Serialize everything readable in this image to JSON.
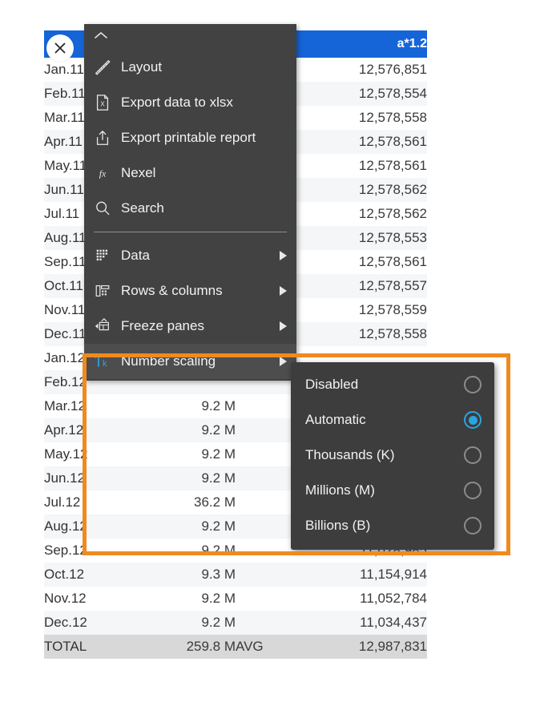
{
  "header": {
    "column_label": "a*1.2",
    "accent_color": "#1565d8"
  },
  "close_button": {
    "icon": "close-icon"
  },
  "table": {
    "columns": [
      "",
      "",
      "",
      "a*1.2"
    ],
    "rows": [
      {
        "label": "Jan.11",
        "value": "",
        "agg": "",
        "value2": "12,576,851"
      },
      {
        "label": "Feb.11",
        "value": "",
        "agg": "",
        "value2": "12,578,554"
      },
      {
        "label": "Mar.11",
        "value": "",
        "agg": "",
        "value2": "12,578,558"
      },
      {
        "label": "Apr.11",
        "value": "",
        "agg": "",
        "value2": "12,578,561"
      },
      {
        "label": "May.11",
        "value": "",
        "agg": "",
        "value2": "12,578,561"
      },
      {
        "label": "Jun.11",
        "value": "",
        "agg": "",
        "value2": "12,578,562"
      },
      {
        "label": "Jul.11",
        "value": "",
        "agg": "",
        "value2": "12,578,562"
      },
      {
        "label": "Aug.11",
        "value": "",
        "agg": "",
        "value2": "12,578,553"
      },
      {
        "label": "Sep.11",
        "value": "",
        "agg": "",
        "value2": "12,578,561"
      },
      {
        "label": "Oct.11",
        "value": "",
        "agg": "",
        "value2": "12,578,557"
      },
      {
        "label": "Nov.11",
        "value": "",
        "agg": "",
        "value2": "12,578,559"
      },
      {
        "label": "Dec.11",
        "value": "",
        "agg": "",
        "value2": "12,578,558"
      },
      {
        "label": "Jan.12",
        "value": "",
        "agg": "",
        "value2": ""
      },
      {
        "label": "Feb.12",
        "value": "",
        "agg": "",
        "value2": ""
      },
      {
        "label": "Mar.12",
        "value": "9.2 M",
        "agg": "",
        "value2": ""
      },
      {
        "label": "Apr.12",
        "value": "9.2 M",
        "agg": "",
        "value2": ""
      },
      {
        "label": "May.12",
        "value": "9.2 M",
        "agg": "",
        "value2": ""
      },
      {
        "label": "Jun.12",
        "value": "9.2 M",
        "agg": "",
        "value2": ""
      },
      {
        "label": "Jul.12",
        "value": "36.2 M",
        "agg": "",
        "value2": ""
      },
      {
        "label": "Aug.12",
        "value": "9.2 M",
        "agg": "",
        "value2": ""
      },
      {
        "label": "Sep.12",
        "value": "9.2 M",
        "agg": "",
        "value2": "11,028,985"
      },
      {
        "label": "Oct.12",
        "value": "9.3 M",
        "agg": "",
        "value2": "11,154,914"
      },
      {
        "label": "Nov.12",
        "value": "9.2 M",
        "agg": "",
        "value2": "11,052,784"
      },
      {
        "label": "Dec.12",
        "value": "9.2 M",
        "agg": "",
        "value2": "11,034,437"
      }
    ],
    "total_row": {
      "label": "TOTAL",
      "value": "259.8 M",
      "agg": "AVG",
      "value2": "12,987,831"
    }
  },
  "context_menu": {
    "collapse_icon": "chevron-up-icon",
    "items": [
      {
        "label": "Layout",
        "icon": "ruler-icon",
        "submenu": false
      },
      {
        "label": "Export data to xlsx",
        "icon": "xlsx-file-icon",
        "submenu": false
      },
      {
        "label": "Export printable report",
        "icon": "export-upload-icon",
        "submenu": false
      },
      {
        "label": "Nexel",
        "icon": "function-fx-icon",
        "submenu": false
      },
      {
        "label": "Search",
        "icon": "search-icon",
        "submenu": false
      }
    ],
    "items2": [
      {
        "label": "Data",
        "icon": "grid-data-icon",
        "submenu": true
      },
      {
        "label": "Rows & columns",
        "icon": "rows-columns-icon",
        "submenu": true
      },
      {
        "label": "Freeze panes",
        "icon": "freeze-panes-icon",
        "submenu": true
      },
      {
        "label": "Number scaling",
        "icon": "number-scaling-icon",
        "submenu": true,
        "highlighted": true
      }
    ]
  },
  "submenu": {
    "title": "Number scaling",
    "options": [
      {
        "label": "Disabled",
        "selected": false
      },
      {
        "label": "Automatic",
        "selected": true
      },
      {
        "label": "Thousands (K)",
        "selected": false
      },
      {
        "label": "Millions (M)",
        "selected": false
      },
      {
        "label": "Billions (B)",
        "selected": false
      }
    ],
    "selected_value": "Automatic",
    "accent_color": "#2aa5e0"
  },
  "highlight_box": {
    "color": "#f08a1e"
  }
}
